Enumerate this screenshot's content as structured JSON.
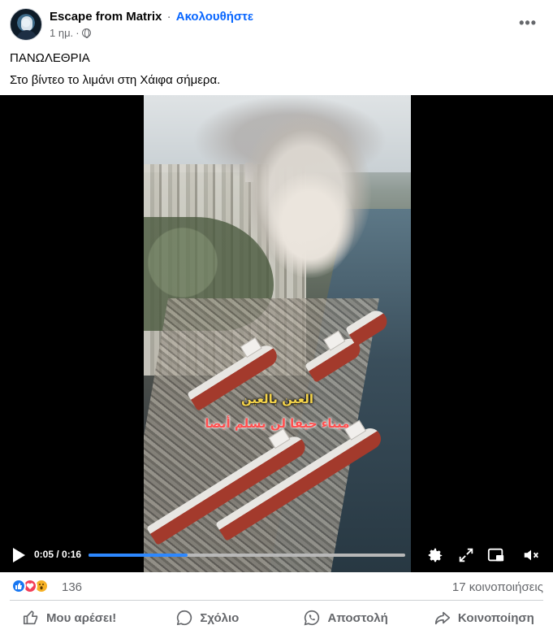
{
  "post": {
    "author": "Escape from Matrix",
    "separator": "·",
    "follow_label": "Ακολουθήστε",
    "time": "1 ημ.",
    "time_separator": "·",
    "line1": "ΠΑΝΩΛΕΘΡΙΑ",
    "line2": "Στο βίντεο το λιμάνι στη Χάιφα σήμερα."
  },
  "video": {
    "overlay_line1": "العين بالعين",
    "overlay_line2": "ميناء حيفا لن يسلم أيضا",
    "time_display": "0:05 / 0:16",
    "progress": 0.3125
  },
  "reactions": {
    "icons": [
      "like-icon",
      "love-icon",
      "wow-icon"
    ],
    "count": "136",
    "shares": "17 κοινοποιήσεις"
  },
  "actions": {
    "like": "Μου αρέσει!",
    "comment": "Σχόλιο",
    "send": "Αποστολή",
    "share": "Κοινοποίηση"
  },
  "colors": {
    "accent": "#0866ff",
    "progress": "#2d88ff",
    "secondary_text": "#65676b"
  }
}
